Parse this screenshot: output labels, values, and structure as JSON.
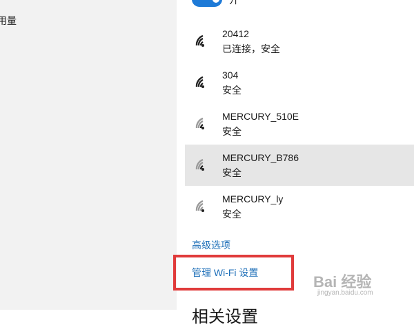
{
  "left_pane": {
    "partial_item": "用量"
  },
  "wifi_toggle": {
    "state_label": "开",
    "on": true
  },
  "networks": [
    {
      "name": "20412",
      "status": "已连接，安全",
      "selected": false
    },
    {
      "name": "304",
      "status": "安全",
      "selected": false
    },
    {
      "name": "MERCURY_510E",
      "status": "安全",
      "selected": false
    },
    {
      "name": "MERCURY_B786",
      "status": "安全",
      "selected": true
    },
    {
      "name": "MERCURY_ly",
      "status": "安全",
      "selected": false
    }
  ],
  "links": {
    "advanced": "高级选项",
    "manage_wifi": "管理 Wi-Fi 设置"
  },
  "section": {
    "heading": "相关设置"
  },
  "watermark": {
    "text": "Bai 经验",
    "sub": "jingyan.baidu.com"
  },
  "colors": {
    "accent": "#1e7ad7",
    "link": "#1e6fb8",
    "highlight": "#e03b3b",
    "selected_row": "#e6e6e6",
    "left_pane_bg": "#f2f2f2"
  }
}
